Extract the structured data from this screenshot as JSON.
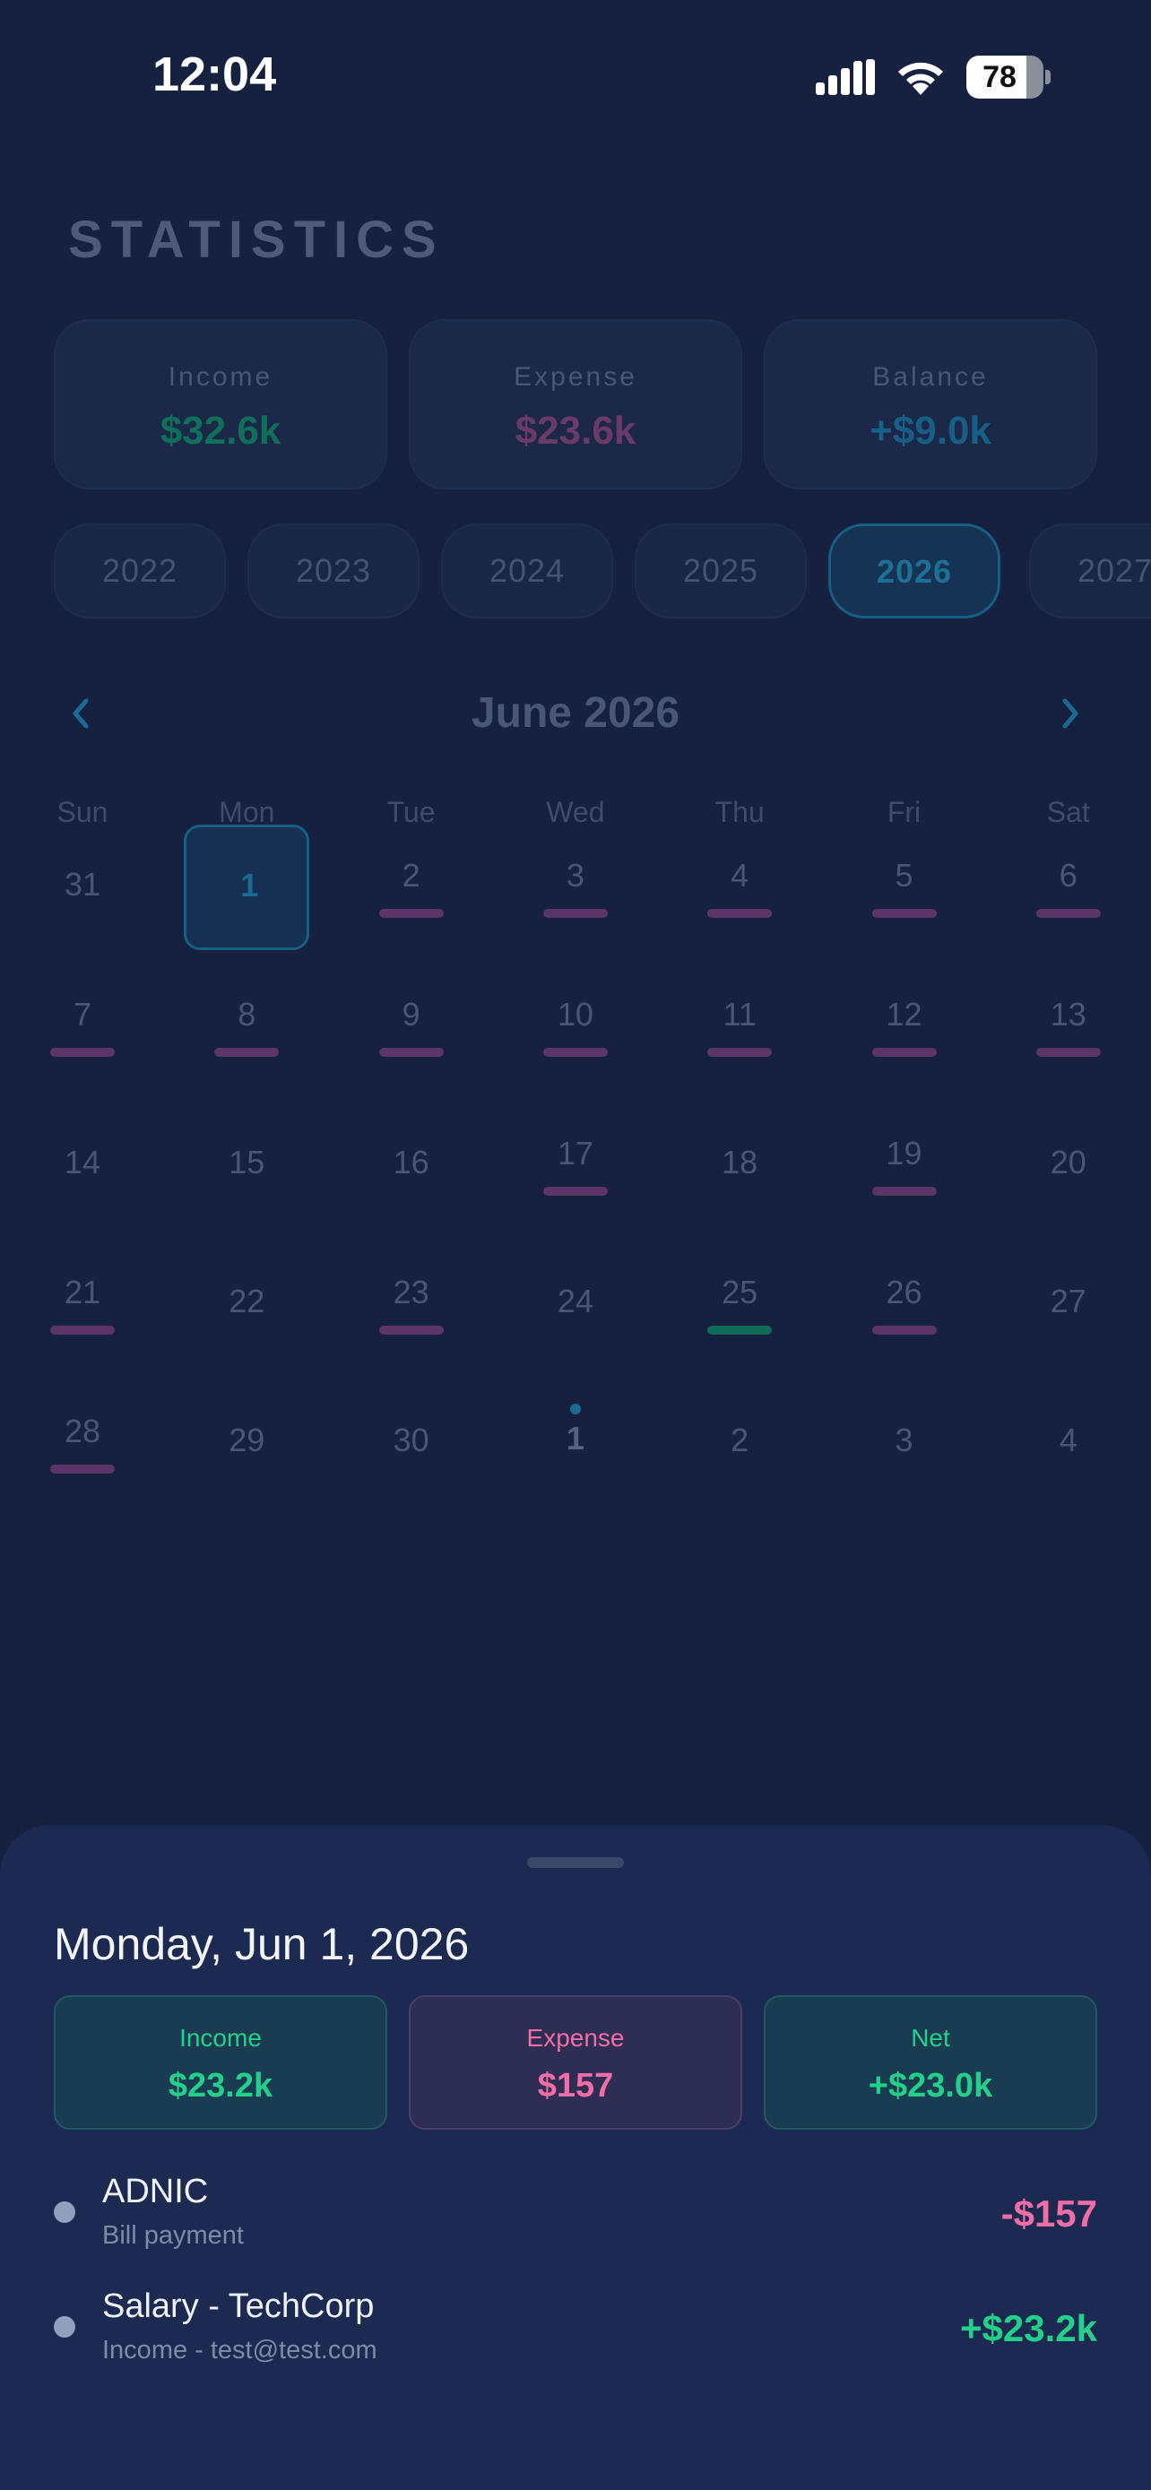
{
  "status_bar": {
    "time": "12:04",
    "battery": 78
  },
  "page": {
    "title": "STATISTICS",
    "summary": [
      {
        "label": "Income",
        "value": "$32.6k",
        "color": "#106f5b"
      },
      {
        "label": "Expense",
        "value": "$23.6k",
        "color": "#6a3a68"
      },
      {
        "label": "Balance",
        "value": "+$9.0k",
        "color": "#175f86"
      }
    ],
    "years": [
      "2022",
      "2023",
      "2024",
      "2025",
      "2026",
      "2027"
    ],
    "selected_year": "2026",
    "month_title": "June 2026",
    "weekdays": [
      "Sun",
      "Mon",
      "Tue",
      "Wed",
      "Thu",
      "Fri",
      "Sat"
    ],
    "weeks": [
      [
        {
          "d": "31",
          "out": true
        },
        {
          "d": "1",
          "sel": true
        },
        {
          "d": "2",
          "bar": "expense"
        },
        {
          "d": "3",
          "bar": "expense"
        },
        {
          "d": "4",
          "bar": "expense"
        },
        {
          "d": "5",
          "bar": "expense"
        },
        {
          "d": "6",
          "bar": "expense"
        }
      ],
      [
        {
          "d": "7",
          "bar": "expense"
        },
        {
          "d": "8",
          "bar": "expense"
        },
        {
          "d": "9",
          "bar": "expense"
        },
        {
          "d": "10",
          "bar": "expense"
        },
        {
          "d": "11",
          "bar": "expense"
        },
        {
          "d": "12",
          "bar": "expense"
        },
        {
          "d": "13",
          "bar": "expense"
        }
      ],
      [
        {
          "d": "14"
        },
        {
          "d": "15"
        },
        {
          "d": "16"
        },
        {
          "d": "17",
          "bar": "expense"
        },
        {
          "d": "18"
        },
        {
          "d": "19",
          "bar": "expense"
        },
        {
          "d": "20"
        }
      ],
      [
        {
          "d": "21",
          "bar": "expense"
        },
        {
          "d": "22"
        },
        {
          "d": "23",
          "bar": "expense"
        },
        {
          "d": "24"
        },
        {
          "d": "25",
          "bar": "income"
        },
        {
          "d": "26",
          "bar": "expense"
        },
        {
          "d": "27"
        }
      ],
      [
        {
          "d": "28",
          "bar": "expense"
        },
        {
          "d": "29"
        },
        {
          "d": "30"
        },
        {
          "d": "1",
          "today": true,
          "out": true
        },
        {
          "d": "2",
          "out": true
        },
        {
          "d": "3",
          "out": true
        },
        {
          "d": "4",
          "out": true
        }
      ]
    ],
    "colors": {
      "expense_bar": "#5b3568",
      "income_bar": "#0f6a56"
    }
  },
  "sheet": {
    "date": "Monday, Jun 1, 2026",
    "income": {
      "label": "Income",
      "value": "$23.2k",
      "color": "#22d08a"
    },
    "expense": {
      "label": "Expense",
      "value": "$157",
      "color": "#f06ea8"
    },
    "net": {
      "label": "Net",
      "value": "+$23.0k",
      "color": "#22d08a"
    },
    "transactions": [
      {
        "title": "ADNIC",
        "subtitle": "Bill payment",
        "amount": "-$157",
        "color": "#f06ea8"
      },
      {
        "title": "Salary - TechCorp",
        "subtitle": "Income - test@test.com",
        "amount": "+$23.2k",
        "color": "#22d08a"
      }
    ]
  }
}
